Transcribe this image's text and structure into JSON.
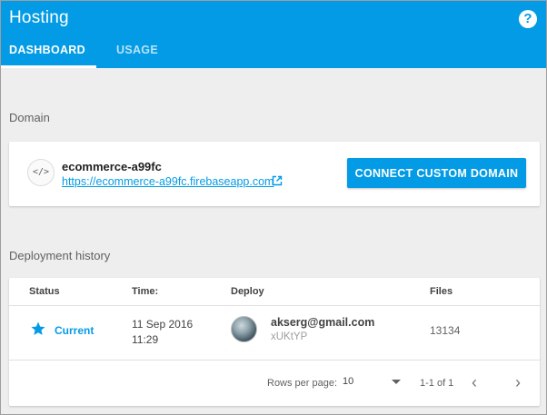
{
  "app": {
    "title": "Hosting",
    "help_icon": "?"
  },
  "tabs": [
    {
      "label": "DASHBOARD",
      "active": true
    },
    {
      "label": "USAGE",
      "active": false
    }
  ],
  "colors": {
    "brand": "#039be5",
    "background": "#eeeeee"
  },
  "domain": {
    "section_label": "Domain",
    "icon": "code-icon",
    "icon_glyph": "</>",
    "site_name": "ecommerce-a99fc",
    "site_url": "https://ecommerce-a99fc.firebaseapp.com",
    "connect_label": "CONNECT CUSTOM DOMAIN"
  },
  "history": {
    "section_label": "Deployment history",
    "columns": {
      "status": "Status",
      "time": "Time:",
      "deploy": "Deploy",
      "files": "Files"
    },
    "rows": [
      {
        "status": "Current",
        "date": "11 Sep 2016",
        "time": "11:29",
        "deployer": "akserg@gmail.com",
        "deploy_id": "xUKtYP",
        "files": "13134"
      }
    ],
    "footer": {
      "rows_per_page_label": "Rows per page:",
      "rows_per_page_value": "10",
      "range": "1-1 of 1"
    }
  }
}
